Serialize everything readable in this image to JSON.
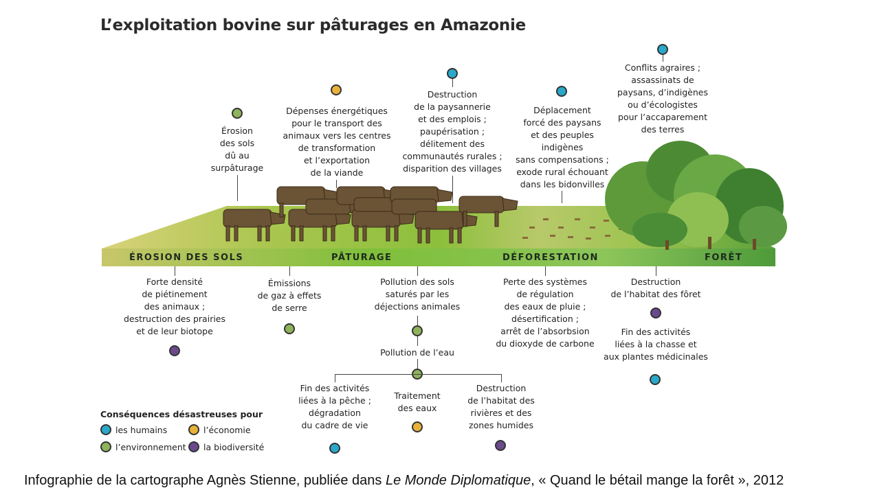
{
  "title": "L’exploitation bovine sur pâturages en Amazonie",
  "colors": {
    "humains": "#2aa8c9",
    "economie": "#e8b13a",
    "environnement": "#8fb35a",
    "biodiversite": "#6a4a8c"
  },
  "bands": {
    "erosion": "ÉROSION DES SOLS",
    "paturage": "PÂTURAGE",
    "deforestation": "DÉFORESTATION",
    "foret": "FORÊT"
  },
  "top": {
    "erosion": "Érosion\ndes sols\ndû au\nsurpâturage",
    "depenses": "Dépenses énergétiques\npour le transport des\nanimaux vers les centres\nde transformation\net l’exportation\nde la viande",
    "destruction_paysannerie": "Destruction\nde la paysannerie\net des emplois ;\npaupérisation ;\ndélitement des\ncommunautés rurales ;\ndisparition des villages",
    "deplacement": "Déplacement\nforcé des paysans\net des peuples\nindigènes\nsans compensations ;\nexode rural échouant\ndans les bidonvilles",
    "conflits": "Conflits agraires ;\nassassinats de\npaysans, d’indigènes\nou d’écologistes\npour l’accaparement\ndes terres"
  },
  "bottom": {
    "densite": "Forte densité\nde piétinement\ndes animaux ;\ndestruction des prairies\net de leur biotope",
    "emissions": "Émissions\nde gaz à effets\nde serre",
    "pollution_sols": "Pollution des sols\nsaturés par les\ndéjections animales",
    "pollution_eau": "Pollution de l’eau",
    "regulation": "Perte des systèmes\nde régulation\ndes eaux de pluie ;\ndésertification ;\narrêt de l’absorbsion\ndu dioxyde de carbone",
    "habitat_foret": "Destruction\nde l’habitat des fôret",
    "chasse": "Fin des activités\nliées à la chasse et\naux plantes médicinales",
    "peche": "Fin des activités\nliées à la pêche ;\ndégradation\ndu cadre de vie",
    "traitement": "Traitement\ndes eaux",
    "habitat_rivieres": "Destruction\nde l’habitat des\nrivières et des\nzones humides"
  },
  "legend": {
    "title": "Conséquences désastreuses pour",
    "humains": "les humains",
    "economie": "l’économie",
    "environnement": "l’environnement",
    "biodiversite": "la biodiversité"
  },
  "caption": {
    "before": "Infographie de la cartographe Agnès Stienne, publiée dans ",
    "journal": "Le Monde Diplomatique",
    "after": ", « Quand le bétail mange la forêt », 2012"
  }
}
